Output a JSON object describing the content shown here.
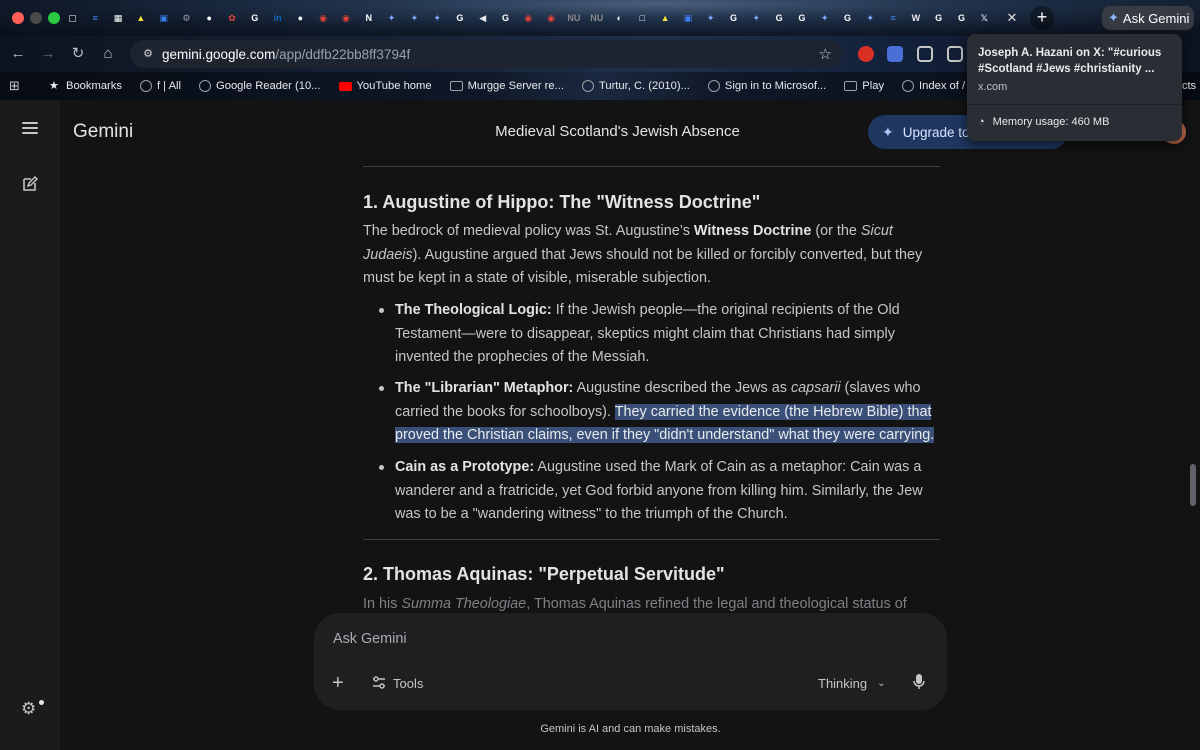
{
  "browser": {
    "url_host": "gemini.google.com",
    "url_path": "/app/ddfb22bb8ff3794f",
    "ask_gemini_label": "Ask Gemini",
    "tab_favicons": [
      {
        "icon": "square-outline-icon",
        "color": "#e8eaed",
        "glyph": "▢"
      },
      {
        "icon": "google-docs-icon",
        "color": "#4285f4",
        "glyph": "≡"
      },
      {
        "icon": "grid-icon",
        "color": "#ffffff",
        "glyph": "▦"
      },
      {
        "icon": "yellow-logo-icon",
        "color": "#f7e03c",
        "glyph": "▲"
      },
      {
        "icon": "blue-square-icon",
        "color": "#3b82f6",
        "glyph": "▣"
      },
      {
        "icon": "chrome-gear-icon",
        "color": "#9aa0a6",
        "glyph": "⚙"
      },
      {
        "icon": "white-circle-icon",
        "color": "#ffffff",
        "glyph": "●"
      },
      {
        "icon": "photos-icon",
        "color": "#ea4335",
        "glyph": "✿"
      },
      {
        "icon": "google-g-icon",
        "color": "#ffffff",
        "glyph": "G"
      },
      {
        "icon": "linkedin-icon",
        "color": "#0a66c2",
        "glyph": "in"
      },
      {
        "icon": "white-circle-icon",
        "color": "#ffffff",
        "glyph": "●"
      },
      {
        "icon": "red-pill-icon",
        "color": "#ea4335",
        "glyph": "◉"
      },
      {
        "icon": "red-pill-icon",
        "color": "#ea4335",
        "glyph": "◉"
      },
      {
        "icon": "news-icon",
        "color": "#ffffff",
        "glyph": "N"
      },
      {
        "icon": "gemini-sparkle-icon",
        "color": "#7fa8ff",
        "glyph": "✦"
      },
      {
        "icon": "gemini-sparkle-icon",
        "color": "#7fa8ff",
        "glyph": "✦"
      },
      {
        "icon": "gemini-sparkle-icon",
        "color": "#7fa8ff",
        "glyph": "✦"
      },
      {
        "icon": "google-g-icon",
        "color": "#ffffff",
        "glyph": "G"
      },
      {
        "icon": "speaker-icon",
        "color": "#e8eaed",
        "glyph": "◀"
      },
      {
        "icon": "google-g-icon",
        "color": "#ffffff",
        "glyph": "G"
      },
      {
        "icon": "red-pill-icon",
        "color": "#ea4335",
        "glyph": "◉"
      },
      {
        "icon": "red-pill-icon",
        "color": "#ea4335",
        "glyph": "◉"
      },
      {
        "icon": "nu-icon",
        "color": "#8a8a8a",
        "glyph": "NU"
      },
      {
        "icon": "nu-icon",
        "color": "#8a8a8a",
        "glyph": "NU"
      },
      {
        "icon": "half-moon-icon",
        "color": "#ffffff",
        "glyph": "◐"
      },
      {
        "icon": "white-square-icon",
        "color": "#ffffff",
        "glyph": "□"
      },
      {
        "icon": "yellow-logo-icon",
        "color": "#f7e03c",
        "glyph": "▲"
      },
      {
        "icon": "blue-square-icon",
        "color": "#3b82f6",
        "glyph": "▣"
      },
      {
        "icon": "gemini-sparkle-icon",
        "color": "#7fa8ff",
        "glyph": "✦"
      },
      {
        "icon": "google-g-icon",
        "color": "#ffffff",
        "glyph": "G"
      },
      {
        "icon": "gemini-sparkle-icon",
        "color": "#7fa8ff",
        "glyph": "✦"
      },
      {
        "icon": "google-g-icon",
        "color": "#ffffff",
        "glyph": "G"
      },
      {
        "icon": "google-g-icon",
        "color": "#ffffff",
        "glyph": "G"
      },
      {
        "icon": "gemini-sparkle-icon",
        "color": "#7fa8ff",
        "glyph": "✦"
      },
      {
        "icon": "google-g-icon",
        "color": "#ffffff",
        "glyph": "G"
      },
      {
        "icon": "gemini-sparkle-icon",
        "color": "#7fa8ff",
        "glyph": "✦"
      },
      {
        "icon": "google-docs-icon",
        "color": "#4285f4",
        "glyph": "≡"
      },
      {
        "icon": "wordpress-icon",
        "color": "#e8eaed",
        "glyph": "W"
      },
      {
        "icon": "google-g-icon",
        "color": "#ffffff",
        "glyph": "G"
      },
      {
        "icon": "google-g-icon",
        "color": "#ffffff",
        "glyph": "G"
      },
      {
        "icon": "x-logo-icon",
        "color": "#e8eaed",
        "glyph": "𝕏"
      }
    ]
  },
  "bookmarks": {
    "items": [
      {
        "label": "Bookmarks",
        "icon": "star-icon",
        "color": "#e8eaed"
      },
      {
        "label": "f | All",
        "icon": "globe-icon",
        "color": "#9aa0a6"
      },
      {
        "label": "Google Reader (10...",
        "icon": "globe-icon",
        "color": "#9aa0a6"
      },
      {
        "label": "YouTube home",
        "icon": "youtube-icon",
        "color": "#ff0000"
      },
      {
        "label": "Murgge Server re...",
        "icon": "folder-icon",
        "color": "#9aa0a6"
      },
      {
        "label": "Turtur, C. (2010)...",
        "icon": "globe-icon",
        "color": "#9aa0a6"
      },
      {
        "label": "Sign in to Microsof...",
        "icon": "globe-icon",
        "color": "#9aa0a6"
      },
      {
        "label": "Play",
        "icon": "folder-icon",
        "color": "#9aa0a6"
      },
      {
        "label": "Index of /",
        "icon": "globe-icon",
        "color": "#9aa0a6"
      }
    ],
    "overflow_label": "cts"
  },
  "popup": {
    "title": "Joseph A. Hazani on X: \"#curious #Scotland #Jews #christianity ...",
    "domain": "x.com",
    "memory": "Memory usage: 460 MB"
  },
  "app": {
    "brand": "Gemini",
    "chat_title": "Medieval Scotland's Jewish Absence",
    "upgrade_label": "Upgrade to",
    "colors": {
      "background": "#131314",
      "highlight": "#3b5079",
      "upgrade": "#1f3760"
    }
  },
  "content": {
    "section1": {
      "heading": "1. Augustine of Hippo: The \"Witness Doctrine\"",
      "intro_1": "The bedrock of medieval policy was St. Augustine’s ",
      "intro_bold": "Witness Doctrine",
      "intro_2": " (or the ",
      "intro_italic": "Sicut Judaeis",
      "intro_3": "). Augustine argued that Jews should not be killed or forcibly converted, but they must be kept in a state of visible, miserable subjection.",
      "bullets": [
        {
          "term": "The Theological Logic:",
          "text": " If the Jewish people—the original recipients of the Old Testament—were to disappear, skeptics might claim that Christians had simply invented the prophecies of the Messiah."
        },
        {
          "term": "The \"Librarian\" Metaphor:",
          "text_1": " Augustine described the Jews as ",
          "italic": "capsarii",
          "text_2": " (slaves who carried the books for schoolboys). ",
          "highlighted": "They carried the evidence (the Hebrew Bible) that proved the Christian claims, even if they \"didn't understand\" what they were carrying."
        },
        {
          "term": "Cain as a Prototype:",
          "text": " Augustine used the Mark of Cain as a metaphor: Cain was a wanderer and a fratricide, yet God forbid anyone from killing him. Similarly, the Jew was to be a \"wandering witness\" to the triumph of the Church."
        }
      ]
    },
    "section2": {
      "heading": "2. Thomas Aquinas: \"Perpetual Servitude\"",
      "intro_1": "In his ",
      "intro_italic": "Summa Theologiae",
      "intro_2": ", Thomas Aquinas refined the legal and theological status of Jewish"
    }
  },
  "composer": {
    "placeholder": "Ask Gemini",
    "tools_label": "Tools",
    "mode_label": "Thinking",
    "disclaimer": "Gemini is AI and can make mistakes."
  }
}
